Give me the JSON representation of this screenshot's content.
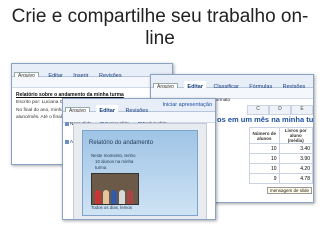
{
  "slide_title": "Crie e compartilhe seu trabalho on-line",
  "doc": {
    "menu": [
      "Arquivo",
      "Editar",
      "Inserir",
      "Revisões"
    ],
    "title": "Relatório sobre o andamento da minha turma",
    "lines": [
      "Escrito por: Luciana Oliveira",
      "No final do ano, minha turma",
      "aluno/mês. Até o final do"
    ]
  },
  "sheet": {
    "menu": [
      "Arquivo",
      "Editar",
      "Classificar",
      "Fórmulas",
      "Revisões"
    ],
    "formula_label": "Formato",
    "heading": "os em um mês na minha turma",
    "col_headers": [
      "C",
      "D",
      "E"
    ],
    "table_headers": [
      "Número de alunos",
      "Livros por aluno (média)"
    ],
    "rows": [
      {
        "a": "10",
        "b": "3.40"
      },
      {
        "a": "10",
        "b": "3.90"
      },
      {
        "a": "10",
        "b": "4.20"
      },
      {
        "a": "9",
        "b": "4.78"
      }
    ],
    "tooltip": "mensagem de slide"
  },
  "pres": {
    "menu": [
      "Arquivo",
      "Editar",
      "Revisões"
    ],
    "start_label": "Iniciar apresentação",
    "toolbar": [
      "Novo slide",
      "Copiar slide",
      "Excluir slide",
      "Adicionar imagem",
      "Adicionar texto"
    ],
    "slide_title": "Relatório do andamento",
    "bullets": [
      "Neste momento, tenho",
      "10 alunos na minha",
      "turma",
      "Todos os dias, lemos"
    ]
  },
  "colors": {
    "accent": "#1c4fa0",
    "window_border": "#8aa2c4"
  }
}
